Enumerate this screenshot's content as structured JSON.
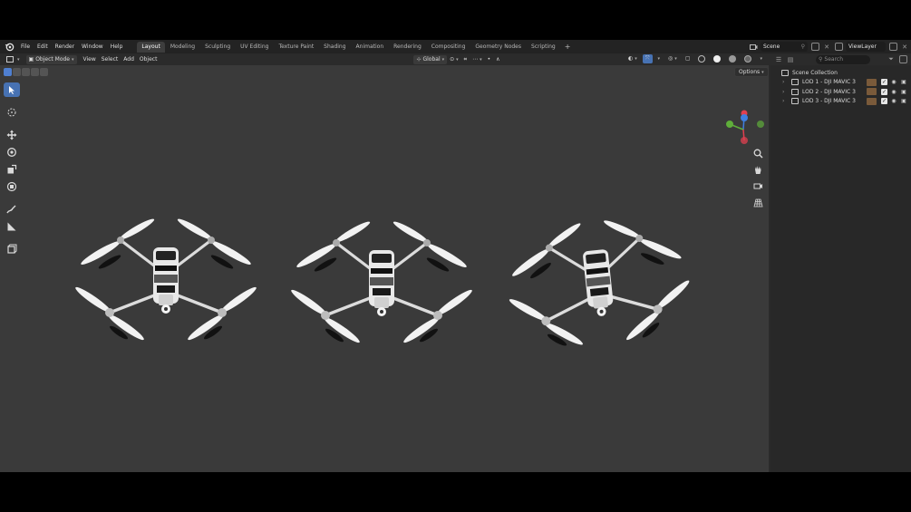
{
  "menu": [
    "File",
    "Edit",
    "Render",
    "Window",
    "Help"
  ],
  "workspaces": [
    "Layout",
    "Modeling",
    "Sculpting",
    "UV Editing",
    "Texture Paint",
    "Shading",
    "Animation",
    "Rendering",
    "Compositing",
    "Geometry Nodes",
    "Scripting"
  ],
  "active_workspace": "Layout",
  "scene": {
    "name": "Scene",
    "view_layer": "ViewLayer"
  },
  "viewport_header": {
    "mode": "Object Mode",
    "menus": [
      "View",
      "Select",
      "Add",
      "Object"
    ],
    "transform_orientation": "Global"
  },
  "viewport": {
    "options_label": "Options"
  },
  "outliner": {
    "search_placeholder": "Search",
    "root": "Scene Collection",
    "collections": [
      {
        "name": "LOD 1 - DJI MAVIC 3"
      },
      {
        "name": "LOD 2 - DJI MAVIC 3"
      },
      {
        "name": "LOD 3 - DJI MAVIC 3"
      }
    ]
  },
  "colors": {
    "accent": "#4772b3",
    "axis_x": "#e04050",
    "axis_y": "#5fae3a",
    "axis_z": "#3f7fe0"
  }
}
